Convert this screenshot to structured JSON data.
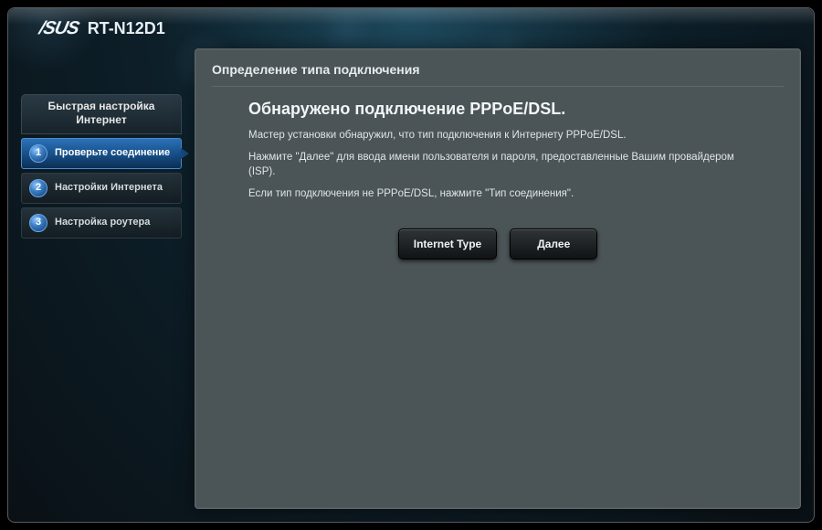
{
  "header": {
    "brand": "/SUS",
    "model": "RT-N12D1"
  },
  "sidebar": {
    "title": "Быстрая настройка Интернет",
    "steps": [
      {
        "num": "1",
        "label": "Проверьте соединение",
        "active": true
      },
      {
        "num": "2",
        "label": "Настройки Интернета",
        "active": false
      },
      {
        "num": "3",
        "label": "Настройка роутера",
        "active": false
      }
    ]
  },
  "panel": {
    "title": "Определение типа подключения",
    "heading": "Обнаружено подключение PPPoE/DSL.",
    "line1": "Мастер установки обнаружил, что тип подключения к Интернету PPPoE/DSL.",
    "line2": "Нажмите \"Далее\" для ввода имени пользователя и пароля, предоставленные Вашим провайдером (ISP).",
    "line3": "Если тип подключения не PPPoE/DSL, нажмите \"Тип соединения\"."
  },
  "buttons": {
    "internet_type": "Internet Type",
    "next": "Далее"
  }
}
